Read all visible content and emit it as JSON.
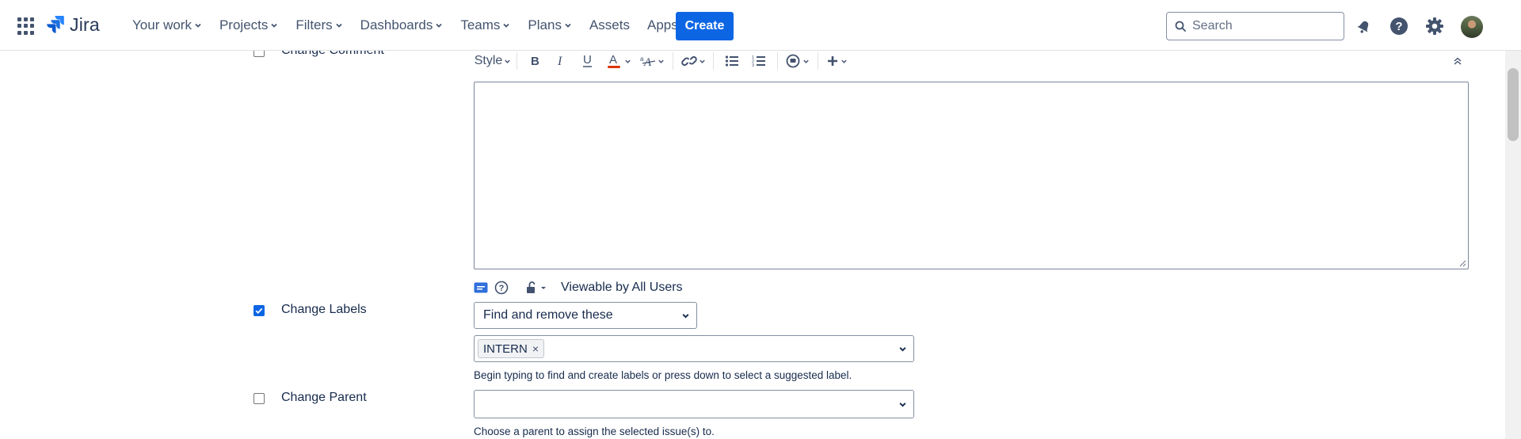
{
  "nav": {
    "logo": "Jira",
    "items": [
      {
        "label": "Your work",
        "dropdown": true
      },
      {
        "label": "Projects",
        "dropdown": true
      },
      {
        "label": "Filters",
        "dropdown": true
      },
      {
        "label": "Dashboards",
        "dropdown": true
      },
      {
        "label": "Teams",
        "dropdown": true
      },
      {
        "label": "Plans",
        "dropdown": true
      },
      {
        "label": "Assets",
        "dropdown": false
      },
      {
        "label": "Apps",
        "dropdown": true
      }
    ],
    "create_label": "Create",
    "search_placeholder": "Search",
    "icons": [
      "notifications-icon",
      "help-icon",
      "settings-icon",
      "avatar"
    ]
  },
  "form": {
    "change_comment": {
      "label": "Change Comment",
      "checked": false
    },
    "editor": {
      "style_label": "Style",
      "toolbar_icons": [
        "bold-icon",
        "italic-icon",
        "underline-icon",
        "text-color-icon",
        "text-effects-icon",
        "link-icon",
        "bullet-list-icon",
        "numbered-list-icon",
        "emoticon-icon",
        "insert-more-icon",
        "collapse-toolbar-icon"
      ],
      "content": ""
    },
    "visibility": {
      "text": "Viewable by All Users"
    },
    "change_labels": {
      "label": "Change Labels",
      "checked": true,
      "operation": "Find and remove these",
      "tags": [
        "INTERN"
      ],
      "help": "Begin typing to find and create labels or press down to select a suggested label."
    },
    "change_parent": {
      "label": "Change Parent",
      "checked": false,
      "value": "",
      "help": "Choose a parent to assign the selected issue(s) to."
    }
  },
  "colors": {
    "primary": "#0c66e4",
    "text": "#172b4d",
    "text_subtle": "#44546f",
    "text_color_underline": "#de350b"
  }
}
